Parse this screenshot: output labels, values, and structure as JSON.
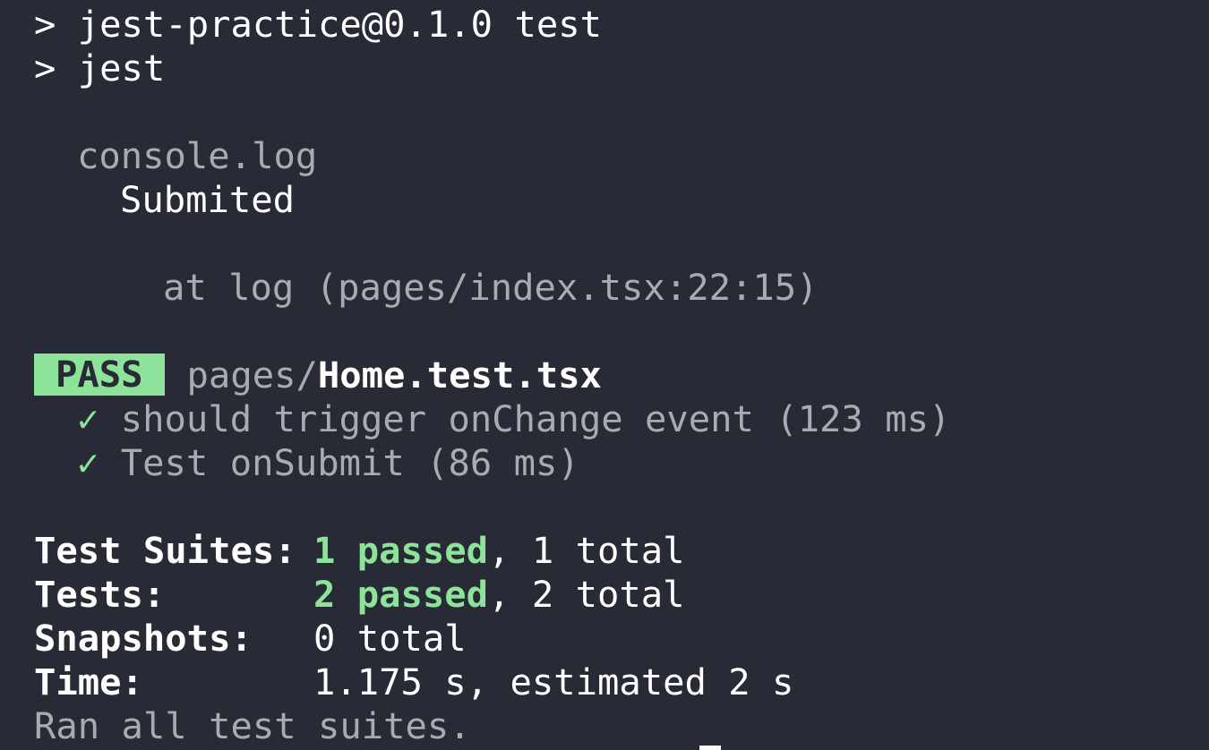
{
  "terminal": {
    "prompt_symbol": ">",
    "script_line": "jest-practice@0.1.0 test",
    "command_line": "jest",
    "console_label": "console.log",
    "console_message": "Submited",
    "console_location": "at log (pages/index.tsx:22:15)",
    "result": {
      "badge": "PASS",
      "file_dir": "pages/",
      "file_name": "Home.test.tsx"
    },
    "tests": [
      {
        "check": "✓",
        "label": "should trigger onChange event (123 ms)"
      },
      {
        "check": "✓",
        "label": "Test onSubmit (86 ms)"
      }
    ],
    "summary": {
      "suites_label": "Test Suites:",
      "suites_passed": "1 passed",
      "suites_rest": ", 1 total",
      "tests_label": "Tests:",
      "tests_passed": "2 passed",
      "tests_rest": ", 2 total",
      "snapshots_label": "Snapshots:",
      "snapshots_value": "0 total",
      "time_label": "Time:",
      "time_value": "1.175 s, estimated 2 s"
    },
    "footer": "Ran all test suites.",
    "colors": {
      "background": "#282a36",
      "text": "#ffffff",
      "dim": "#a9abb1",
      "pass": "#8ee39b"
    }
  }
}
